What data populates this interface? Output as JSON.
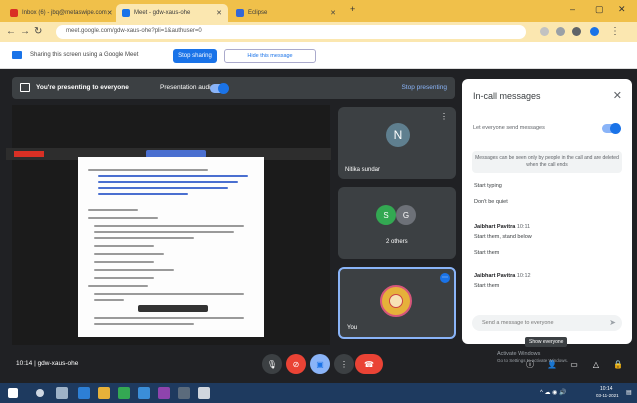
{
  "browser": {
    "tabs": [
      {
        "label": "Inbox (6) - jbq@metaswipe.com",
        "fav": "#d93025"
      },
      {
        "label": "Meet - gdw-xaus-ohe",
        "fav": "#1a73e8"
      },
      {
        "label": "Eclipse",
        "fav": "#3367d6"
      }
    ],
    "url": "meet.google.com/gdw-xaus-ohe?pli=1&authuser=0"
  },
  "share_bar": {
    "text": "Sharing this screen using a Google Meet",
    "stop_label": "Stop sharing",
    "hide_label": "Hide this message"
  },
  "presentation": {
    "banner": "You're presenting to everyone",
    "audio_label": "Presentation audio",
    "stop_label": "Stop presenting"
  },
  "participants": [
    {
      "name": "Nitika sundar",
      "initial": "N",
      "color": "#5f7f8f"
    },
    {
      "name": "2 others",
      "initials": [
        "S",
        "G"
      ],
      "colors": [
        "#33a852",
        "#6d7178"
      ]
    },
    {
      "name": "You"
    }
  ],
  "chat": {
    "title": "In-call messages",
    "toggle_label": "Let everyone send messages",
    "note": "Messages can be seen only by people in the call and are deleted when the call ends",
    "messages": [
      {
        "sender": "",
        "time": "",
        "texts": [
          "Start typing"
        ]
      },
      {
        "sender": "",
        "time": "",
        "texts": [
          "Don't be quiet"
        ]
      },
      {
        "sender": "Jaibhart Pavitra",
        "time": "10:11",
        "texts": [
          "Start them, stand below",
          "Start them"
        ]
      },
      {
        "sender": "Jaibhart Pavitra",
        "time": "10:12",
        "texts": [
          "Start them"
        ]
      }
    ],
    "input_placeholder": "Send a message to everyone"
  },
  "bottom": {
    "meeting_code": "10:14 | gdw-xaus-ohe",
    "tooltip": "Show everyone",
    "activate1": "Activate Windows",
    "activate2": "Go to Settings to activate Windows."
  },
  "taskbar": {
    "time": "10:14",
    "date": "03-11-2021"
  }
}
